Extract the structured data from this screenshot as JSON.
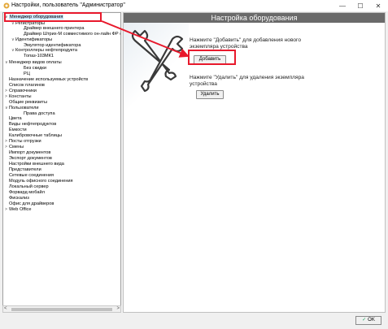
{
  "window": {
    "title": "Настройки, пользователь \"Администратор\"",
    "controls": {
      "minimize": "—",
      "maximize": "☐",
      "close": "✕"
    }
  },
  "tree": {
    "items": [
      {
        "label": "Менеджер оборудования",
        "arrow": "∨",
        "selected": true
      },
      {
        "label": "Регистраторы",
        "arrow": "∨"
      },
      {
        "label": "Драйвер внешнего принтера",
        "arrow": ""
      },
      {
        "label": "Драйвер Штрих-М совместимого он-лайн ФР (ФЗ",
        "arrow": ""
      },
      {
        "label": "Идентификаторы",
        "arrow": "∨"
      },
      {
        "label": "Эмулятор идентификатора",
        "arrow": ""
      },
      {
        "label": "Контроллеры нефтепродукта",
        "arrow": "∨"
      },
      {
        "label": "Топаз-103МК1",
        "arrow": ""
      },
      {
        "label": "Менеджер видов оплаты",
        "arrow": "∨"
      },
      {
        "label": "Без скидки",
        "arrow": ""
      },
      {
        "label": "РЦ",
        "arrow": ""
      },
      {
        "label": "Назначение используемых устройств",
        "arrow": ""
      },
      {
        "label": "Список плагинов",
        "arrow": ""
      },
      {
        "label": "Справочники",
        "arrow": ">"
      },
      {
        "label": "Константы",
        "arrow": ">"
      },
      {
        "label": "Общие реквизиты",
        "arrow": ""
      },
      {
        "label": "Пользователи",
        "arrow": "∨"
      },
      {
        "label": "Права доступа",
        "arrow": ""
      },
      {
        "label": "Цвета",
        "arrow": ""
      },
      {
        "label": "Виды нефтепродуктов",
        "arrow": ""
      },
      {
        "label": "Емкости",
        "arrow": ""
      },
      {
        "label": "Калибровочные таблицы",
        "arrow": ""
      },
      {
        "label": "Посты отгрузки",
        "arrow": ">"
      },
      {
        "label": "Смены",
        "arrow": ">"
      },
      {
        "label": "Импорт документов",
        "arrow": ""
      },
      {
        "label": "Экспорт документов",
        "arrow": ""
      },
      {
        "label": "Настройки внешнего вида",
        "arrow": ""
      },
      {
        "label": "Представители",
        "arrow": ""
      },
      {
        "label": "Сетевые соединения",
        "arrow": ""
      },
      {
        "label": "Модуль офисного соединения",
        "arrow": ""
      },
      {
        "label": "Локальный сервер",
        "arrow": ""
      },
      {
        "label": "Форвард мобайл",
        "arrow": ""
      },
      {
        "label": "Фискализ",
        "arrow": ""
      },
      {
        "label": "Офис для драйверов",
        "arrow": ""
      },
      {
        "label": "Web Office",
        "arrow": ">"
      }
    ],
    "scroll_left": "<",
    "scroll_right": ">"
  },
  "content": {
    "header_title": "Настройка оборудования",
    "add_hint": "Нажмите \"Добавить\" для добавления нового экземпляра устройства",
    "add_button": "Добавить",
    "remove_hint": "Нажмите \"Удалить\" для удаления экземпляра устройства",
    "remove_button": "Удалить"
  },
  "footer": {
    "ok_check": "✓",
    "ok_button": "OK"
  },
  "colors": {
    "header_bg": "#6a6a6a",
    "annotation": "#e8192c",
    "selection": "#cce4f7"
  }
}
